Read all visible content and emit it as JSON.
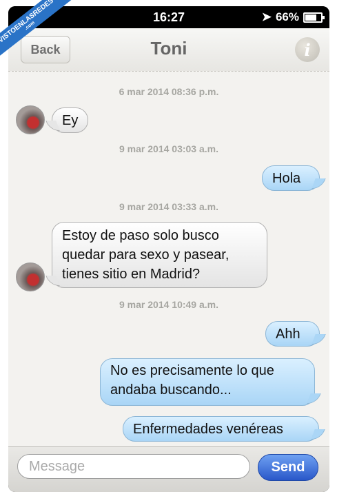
{
  "status_bar": {
    "time": "16:27",
    "battery": "66%"
  },
  "nav": {
    "back_label": "Back",
    "title": "Toni",
    "info_glyph": "i"
  },
  "watermark": {
    "text": "VISTOENLASREDES",
    "sub": ".com"
  },
  "messages": {
    "ts1": "6 mar 2014 08:36 p.m.",
    "m1": "Ey",
    "ts2": "9 mar 2014 03:03 a.m.",
    "m2": "Hola",
    "ts3": "9 mar 2014 03:33 a.m.",
    "m3": "Estoy de paso solo busco quedar para sexo y pasear, tienes sitio en Madrid?",
    "ts4": "9 mar 2014 10:49 a.m.",
    "m4": "Ahh",
    "m5": "No es precisamente lo que andaba buscando...",
    "m6": "Enfermedades venéreas"
  },
  "compose": {
    "placeholder": "Message",
    "send_label": "Send"
  },
  "colors": {
    "incoming": "#e6e6e6",
    "outgoing": "#abd6f6",
    "send": "#2957c9"
  }
}
